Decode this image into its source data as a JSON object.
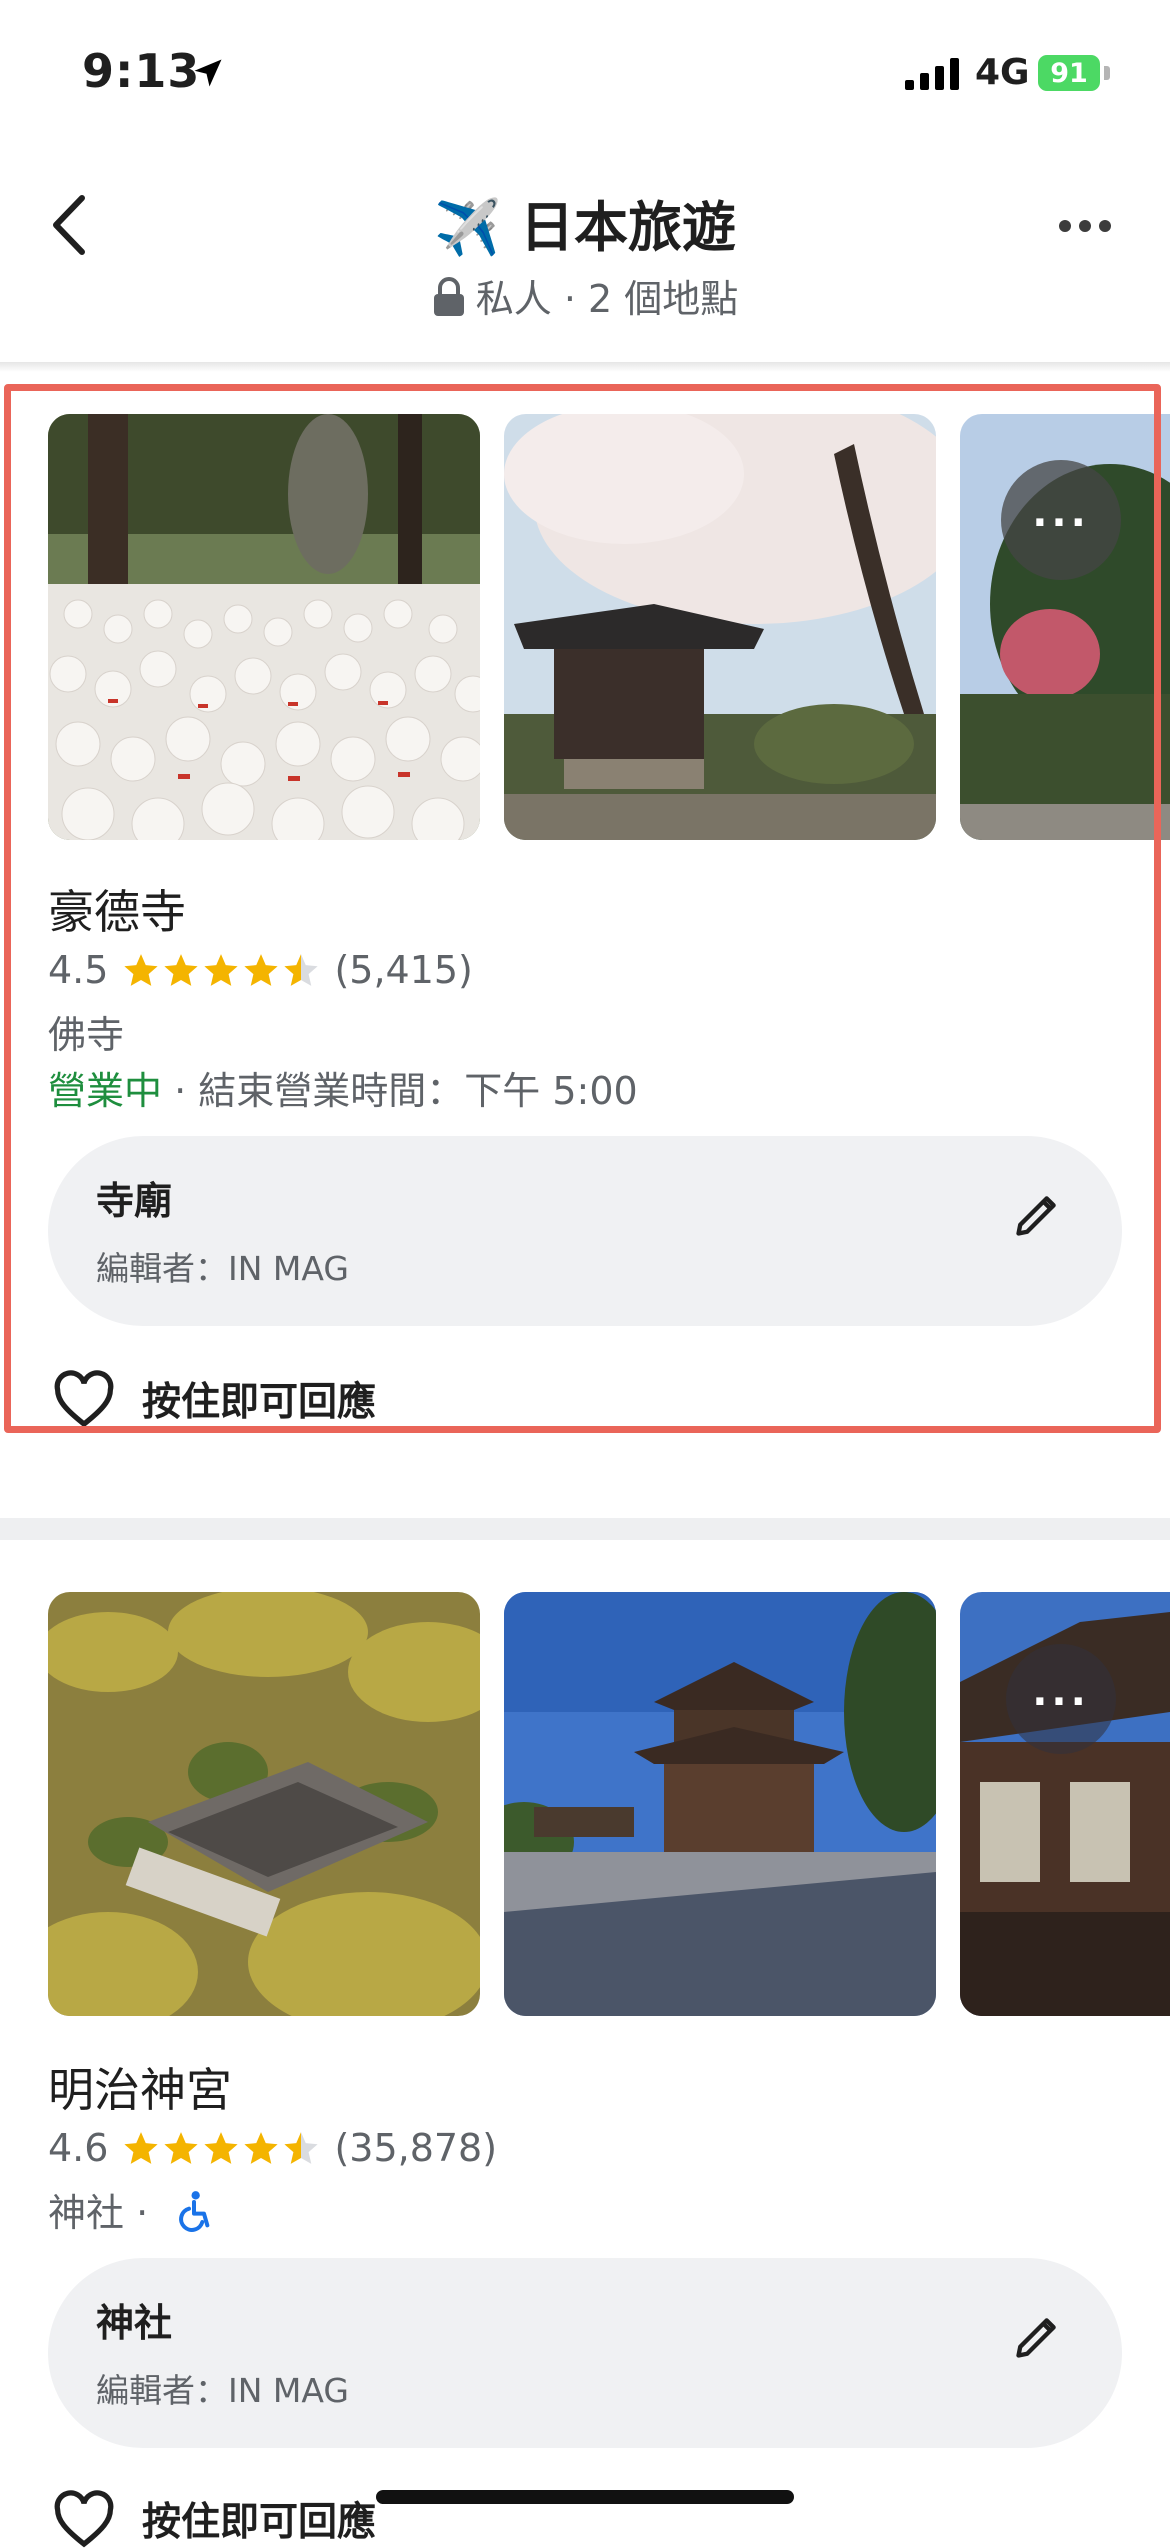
{
  "status_bar": {
    "time": "9:13",
    "network": "4G",
    "battery": "91"
  },
  "header": {
    "title": "✈️ 日本旅遊",
    "subtitle": "私人 · 2 個地點"
  },
  "places": [
    {
      "name": "豪德寺",
      "rating": "4.5",
      "stars": 4.5,
      "reviews": "(5,415)",
      "category": "佛寺",
      "open_status": "營業中",
      "hours": " · 結束營業時間：下午 5:00",
      "note_title": "寺廟",
      "note_editor": "編輯者：IN MAG",
      "react_label": "按住即可回應"
    },
    {
      "name": "明治神宮",
      "rating": "4.6",
      "stars": 4.5,
      "reviews": "(35,878)",
      "category": "神社 · ",
      "note_title": "神社",
      "note_editor": "編輯者：IN MAG",
      "react_label": "按住即可回應"
    }
  ],
  "colors": {
    "highlight": "#ea6559",
    "star": "#f4b400",
    "open_green": "#1e8e3e",
    "accessibility_blue": "#1a73e8"
  },
  "icons": [
    "location-arrow-icon",
    "signal-icon",
    "battery-icon",
    "back-icon",
    "lock-icon",
    "more-icon",
    "star-icon",
    "edit-icon",
    "heart-icon",
    "wheelchair-icon"
  ]
}
